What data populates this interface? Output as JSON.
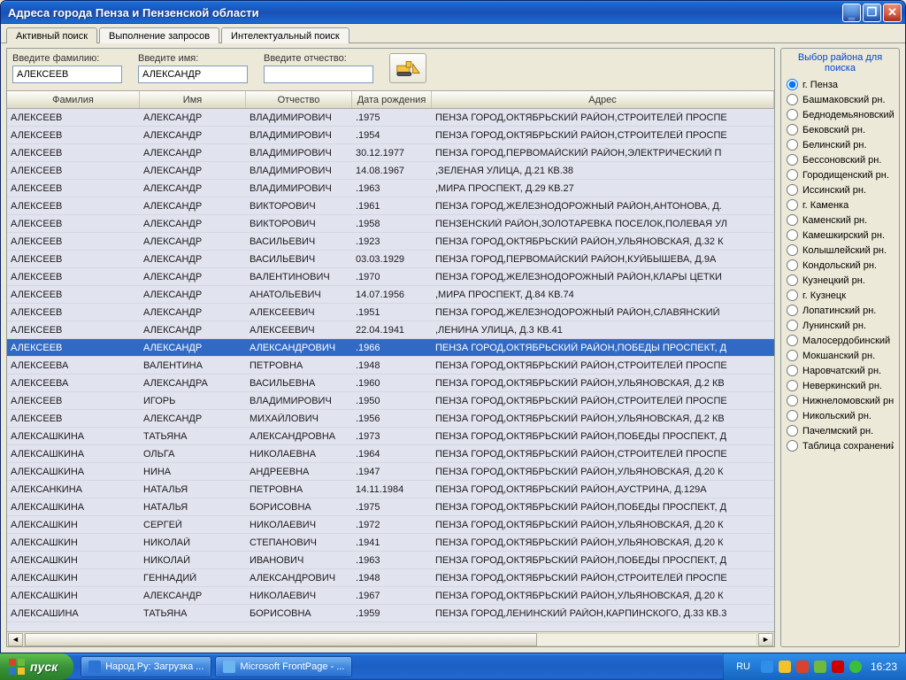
{
  "window": {
    "title": "Адреса города Пенза и Пензенской области"
  },
  "tabs": [
    {
      "label": "Активный поиск",
      "active": true
    },
    {
      "label": "Выполнение запросов",
      "active": false
    },
    {
      "label": "Интелектуальный поиск",
      "active": false
    }
  ],
  "search": {
    "surname_label": "Введите фамилию:",
    "name_label": "Введите имя:",
    "patronymic_label": "Введите отчество:",
    "surname_value": "АЛЕКСЕЕВ",
    "name_value": "АЛЕКСАНДР",
    "patronymic_value": ""
  },
  "columns": [
    {
      "label": "Фамилия"
    },
    {
      "label": "Имя"
    },
    {
      "label": "Отчество"
    },
    {
      "label": "Дата рождения"
    },
    {
      "label": "Адрес"
    }
  ],
  "rows": [
    {
      "f": "АЛЕКСЕЕВ",
      "i": "АЛЕКСАНДР",
      "o": "ВЛАДИМИРОВИЧ",
      "d": ".1975",
      "a": "ПЕНЗА ГОРОД,ОКТЯБРЬСКИЙ РАЙОН,СТРОИТЕЛЕЙ ПРОСПЕ"
    },
    {
      "f": "АЛЕКСЕЕВ",
      "i": "АЛЕКСАНДР",
      "o": "ВЛАДИМИРОВИЧ",
      "d": ".1954",
      "a": "ПЕНЗА ГОРОД,ОКТЯБРЬСКИЙ РАЙОН,СТРОИТЕЛЕЙ ПРОСПЕ"
    },
    {
      "f": "АЛЕКСЕЕВ",
      "i": "АЛЕКСАНДР",
      "o": "ВЛАДИМИРОВИЧ",
      "d": "30.12.1977",
      "a": "ПЕНЗА ГОРОД,ПЕРВОМАЙСКИЙ РАЙОН,ЭЛЕКТРИЧЕСКИЙ П"
    },
    {
      "f": "АЛЕКСЕЕВ",
      "i": "АЛЕКСАНДР",
      "o": "ВЛАДИМИРОВИЧ",
      "d": "14.08.1967",
      "a": ",ЗЕЛЕНАЯ УЛИЦА, Д.21 КВ.38"
    },
    {
      "f": "АЛЕКСЕЕВ",
      "i": "АЛЕКСАНДР",
      "o": "ВЛАДИМИРОВИЧ",
      "d": ".1963",
      "a": ",МИРА ПРОСПЕКТ, Д.29 КВ.27"
    },
    {
      "f": "АЛЕКСЕЕВ",
      "i": "АЛЕКСАНДР",
      "o": "ВИКТОРОВИЧ",
      "d": ".1961",
      "a": "ПЕНЗА ГОРОД,ЖЕЛЕЗНОДОРОЖНЫЙ РАЙОН,АНТОНОВА, Д."
    },
    {
      "f": "АЛЕКСЕЕВ",
      "i": "АЛЕКСАНДР",
      "o": "ВИКТОРОВИЧ",
      "d": ".1958",
      "a": "ПЕНЗЕНСКИЙ РАЙОН,ЗОЛОТАРЕВКА ПОСЕЛОК,ПОЛЕВАЯ УЛ"
    },
    {
      "f": "АЛЕКСЕЕВ",
      "i": "АЛЕКСАНДР",
      "o": "ВАСИЛЬЕВИЧ",
      "d": ".1923",
      "a": "ПЕНЗА ГОРОД,ОКТЯБРЬСКИЙ РАЙОН,УЛЬЯНОВСКАЯ, Д.32 К"
    },
    {
      "f": "АЛЕКСЕЕВ",
      "i": "АЛЕКСАНДР",
      "o": "ВАСИЛЬЕВИЧ",
      "d": "03.03.1929",
      "a": "ПЕНЗА ГОРОД,ПЕРВОМАЙСКИЙ РАЙОН,КУЙБЫШЕВА, Д.9А"
    },
    {
      "f": "АЛЕКСЕЕВ",
      "i": "АЛЕКСАНДР",
      "o": "ВАЛЕНТИНОВИЧ",
      "d": ".1970",
      "a": "ПЕНЗА ГОРОД,ЖЕЛЕЗНОДОРОЖНЫЙ РАЙОН,КЛАРЫ ЦЕТКИ"
    },
    {
      "f": "АЛЕКСЕЕВ",
      "i": "АЛЕКСАНДР",
      "o": "АНАТОЛЬЕВИЧ",
      "d": "14.07.1956",
      "a": ",МИРА ПРОСПЕКТ, Д.84 КВ.74"
    },
    {
      "f": "АЛЕКСЕЕВ",
      "i": "АЛЕКСАНДР",
      "o": "АЛЕКСЕЕВИЧ",
      "d": ".1951",
      "a": "ПЕНЗА ГОРОД,ЖЕЛЕЗНОДОРОЖНЫЙ РАЙОН,СЛАВЯНСКИЙ"
    },
    {
      "f": "АЛЕКСЕЕВ",
      "i": "АЛЕКСАНДР",
      "o": "АЛЕКСЕЕВИЧ",
      "d": "22.04.1941",
      "a": ",ЛЕНИНА УЛИЦА, Д.3 КВ.41"
    },
    {
      "f": "АЛЕКСЕЕВ",
      "i": "АЛЕКСАНДР",
      "o": "АЛЕКСАНДРОВИЧ",
      "d": ".1966",
      "a": "ПЕНЗА ГОРОД,ОКТЯБРЬСКИЙ РАЙОН,ПОБЕДЫ ПРОСПЕКТ, Д",
      "selected": true
    },
    {
      "f": "АЛЕКСЕЕВА",
      "i": "ВАЛЕНТИНА",
      "o": "ПЕТРОВНА",
      "d": ".1948",
      "a": "ПЕНЗА ГОРОД,ОКТЯБРЬСКИЙ РАЙОН,СТРОИТЕЛЕЙ ПРОСПЕ"
    },
    {
      "f": "АЛЕКСЕЕВА",
      "i": "АЛЕКСАНДРА",
      "o": "ВАСИЛЬЕВНА",
      "d": ".1960",
      "a": "ПЕНЗА ГОРОД,ОКТЯБРЬСКИЙ РАЙОН,УЛЬЯНОВСКАЯ, Д.2 КВ"
    },
    {
      "f": "АЛЕКСЕЕВ",
      "i": "ИГОРЬ",
      "o": "ВЛАДИМИРОВИЧ",
      "d": ".1950",
      "a": "ПЕНЗА ГОРОД,ОКТЯБРЬСКИЙ РАЙОН,СТРОИТЕЛЕЙ ПРОСПЕ"
    },
    {
      "f": "АЛЕКСЕЕВ",
      "i": "АЛЕКСАНДР",
      "o": "МИХАЙЛОВИЧ",
      "d": ".1956",
      "a": "ПЕНЗА ГОРОД,ОКТЯБРЬСКИЙ РАЙОН,УЛЬЯНОВСКАЯ, Д.2 КВ"
    },
    {
      "f": "АЛЕКСАШКИНА",
      "i": "ТАТЬЯНА",
      "o": "АЛЕКСАНДРОВНА",
      "d": ".1973",
      "a": "ПЕНЗА ГОРОД,ОКТЯБРЬСКИЙ РАЙОН,ПОБЕДЫ ПРОСПЕКТ, Д"
    },
    {
      "f": "АЛЕКСАШКИНА",
      "i": "ОЛЬГА",
      "o": "НИКОЛАЕВНА",
      "d": ".1964",
      "a": "ПЕНЗА ГОРОД,ОКТЯБРЬСКИЙ РАЙОН,СТРОИТЕЛЕЙ ПРОСПЕ"
    },
    {
      "f": "АЛЕКСАШКИНА",
      "i": "НИНА",
      "o": "АНДРЕЕВНА",
      "d": ".1947",
      "a": "ПЕНЗА ГОРОД,ОКТЯБРЬСКИЙ РАЙОН,УЛЬЯНОВСКАЯ, Д.20 К"
    },
    {
      "f": "АЛЕКСАНКИНА",
      "i": "НАТАЛЬЯ",
      "o": "ПЕТРОВНА",
      "d": "14.11.1984",
      "a": "ПЕНЗА ГОРОД,ОКТЯБРЬСКИЙ РАЙОН,АУСТРИНА, Д.129A"
    },
    {
      "f": "АЛЕКСАШКИНА",
      "i": "НАТАЛЬЯ",
      "o": "БОРИСОВНА",
      "d": ".1975",
      "a": "ПЕНЗА ГОРОД,ОКТЯБРЬСКИЙ РАЙОН,ПОБЕДЫ ПРОСПЕКТ, Д"
    },
    {
      "f": "АЛЕКСАШКИН",
      "i": "СЕРГЕЙ",
      "o": "НИКОЛАЕВИЧ",
      "d": ".1972",
      "a": "ПЕНЗА ГОРОД,ОКТЯБРЬСКИЙ РАЙОН,УЛЬЯНОВСКАЯ, Д.20 К"
    },
    {
      "f": "АЛЕКСАШКИН",
      "i": "НИКОЛАЙ",
      "o": "СТЕПАНОВИЧ",
      "d": ".1941",
      "a": "ПЕНЗА ГОРОД,ОКТЯБРЬСКИЙ РАЙОН,УЛЬЯНОВСКАЯ, Д.20 К"
    },
    {
      "f": "АЛЕКСАШКИН",
      "i": "НИКОЛАЙ",
      "o": "ИВАНОВИЧ",
      "d": ".1963",
      "a": "ПЕНЗА ГОРОД,ОКТЯБРЬСКИЙ РАЙОН,ПОБЕДЫ ПРОСПЕКТ, Д"
    },
    {
      "f": "АЛЕКСАШКИН",
      "i": "ГЕННАДИЙ",
      "o": "АЛЕКСАНДРОВИЧ",
      "d": ".1948",
      "a": "ПЕНЗА ГОРОД,ОКТЯБРЬСКИЙ РАЙОН,СТРОИТЕЛЕЙ ПРОСПЕ"
    },
    {
      "f": "АЛЕКСАШКИН",
      "i": "АЛЕКСАНДР",
      "o": "НИКОЛАЕВИЧ",
      "d": ".1967",
      "a": "ПЕНЗА ГОРОД,ОКТЯБРЬСКИЙ РАЙОН,УЛЬЯНОВСКАЯ, Д.20 К"
    },
    {
      "f": "АЛЕКСАШИНА",
      "i": "ТАТЬЯНА",
      "o": "БОРИСОВНА",
      "d": ".1959",
      "a": "ПЕНЗА ГОРОД,ЛЕНИНСКИЙ РАЙОН,КАРПИНСКОГО, Д.33 КВ.3"
    }
  ],
  "regions": {
    "title": "Выбор района для поиска",
    "items": [
      "г. Пенза",
      "Башмаковский рн.",
      "Беднодемьяновский рн.",
      "Бековский рн.",
      "Белинский рн.",
      "Бессоновский рн.",
      "Городищенский рн.",
      "Иссинский рн.",
      "г. Каменка",
      "Каменский рн.",
      "Камешкирский рн.",
      "Колышлейский рн.",
      "Кондольский рн.",
      "Кузнецкий рн.",
      "г. Кузнецк",
      "Лопатинский рн.",
      "Лунинский рн.",
      "Малосердобинский рн.",
      "Мокшанский рн.",
      "Наровчатский рн.",
      "Неверкинский рн.",
      "Нижнеломовский рн.",
      "Никольский рн.",
      "Пачелмский рн.",
      "Таблица сохранений"
    ],
    "selected_index": 0
  },
  "taskbar": {
    "start": "пуск",
    "tasks": [
      {
        "label": "Народ.Ру: Загрузка ...",
        "icon": "#2b74d4"
      },
      {
        "label": "Microsoft FrontPage - ...",
        "icon": "#6bb6f0"
      }
    ],
    "lang": "RU",
    "clock": "16:23"
  }
}
